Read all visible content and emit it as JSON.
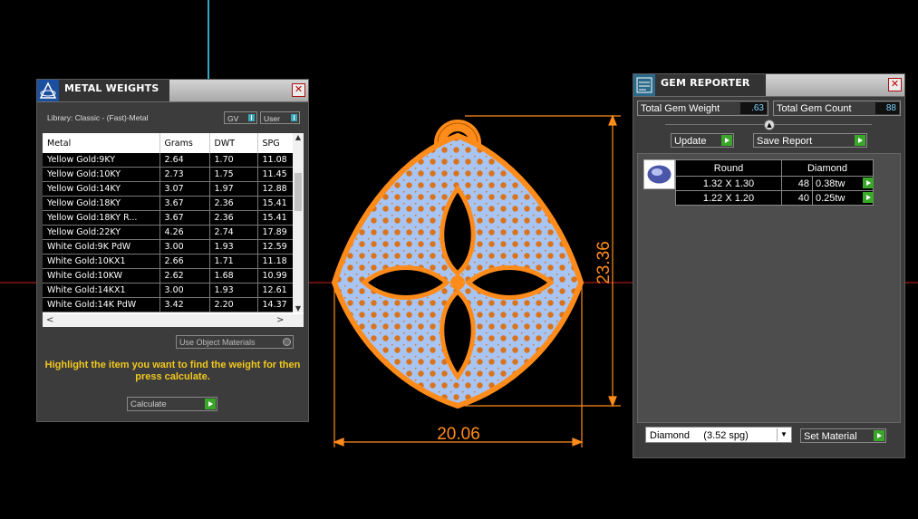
{
  "viewport": {
    "width_dim": "20.06",
    "height_dim": "23.36",
    "colors": {
      "model": "#ff8c1a",
      "gem": "#a8c4f2",
      "axis_red": "#cc1f1f",
      "axis_cyan": "#36a9c2"
    }
  },
  "metal_weights": {
    "title": "METAL WEIGHTS",
    "library_label": "Library: Classic - (Fast)-Metal",
    "gv_label": "GV",
    "user_label": "User",
    "columns": [
      "Metal",
      "Grams",
      "DWT",
      "SPG"
    ],
    "rows": [
      [
        "Yellow Gold:9KY",
        "2.64",
        "1.70",
        "11.08"
      ],
      [
        "Yellow Gold:10KY",
        "2.73",
        "1.75",
        "11.45"
      ],
      [
        "Yellow Gold:14KY",
        "3.07",
        "1.97",
        "12.88"
      ],
      [
        "Yellow Gold:18KY",
        "3.67",
        "2.36",
        "15.41"
      ],
      [
        "Yellow Gold:18KY R...",
        "3.67",
        "2.36",
        "15.41"
      ],
      [
        "Yellow Gold:22KY",
        "4.26",
        "2.74",
        "17.89"
      ],
      [
        "White Gold:9K PdW",
        "3.00",
        "1.93",
        "12.59"
      ],
      [
        "White Gold:10KX1",
        "2.66",
        "1.71",
        "11.18"
      ],
      [
        "White Gold:10KW",
        "2.62",
        "1.68",
        "10.99"
      ],
      [
        "White Gold:14KX1",
        "3.00",
        "1.93",
        "12.61"
      ],
      [
        "White Gold:14K PdW",
        "3.42",
        "2.20",
        "14.37"
      ]
    ],
    "use_object_materials": "Use Object Materials",
    "help_text": "Highlight the item you want to find the weight for then press calculate.",
    "calculate_label": "Calculate"
  },
  "gem_reporter": {
    "title": "GEM REPORTER",
    "total_weight_label": "Total Gem Weight",
    "total_weight_value": ".63",
    "total_count_label": "Total Gem Count",
    "total_count_value": "88",
    "update_label": "Update",
    "save_report_label": "Save Report",
    "table_headers": [
      "Round",
      "Diamond"
    ],
    "rows": [
      {
        "size": "1.32 X 1.30",
        "count": "48",
        "weight": "0.38tw"
      },
      {
        "size": "1.22 X 1.20",
        "count": "40",
        "weight": "0.25tw"
      }
    ],
    "material_select": "Diamond     (3.52 spg)",
    "set_material_label": "Set Material"
  }
}
